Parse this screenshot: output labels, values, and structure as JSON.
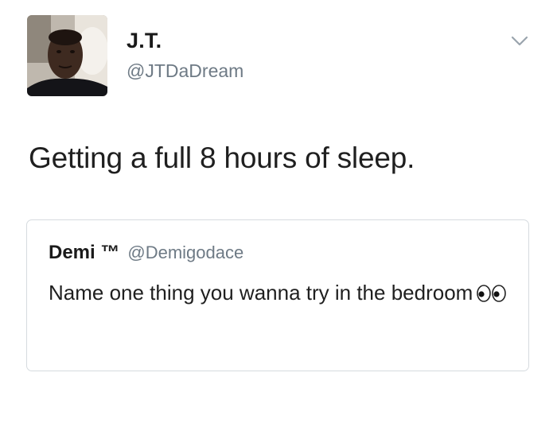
{
  "author": {
    "name": "J.T.",
    "handle": "@JTDaDream"
  },
  "tweet": {
    "text": "Getting a full 8 hours of sleep."
  },
  "quoted_tweet": {
    "name": "Demi ™",
    "handle": "@Demigodace",
    "text": "Name one thing you wanna try in the bedroom",
    "emoji_icon": "eyes-emoji-icon"
  },
  "icons": {
    "menu": "chevron-down-icon",
    "avatar": "profile-photo"
  },
  "colors": {
    "text": "#14171a",
    "secondary": "#6e7a85",
    "border": "#d6dbdf"
  }
}
